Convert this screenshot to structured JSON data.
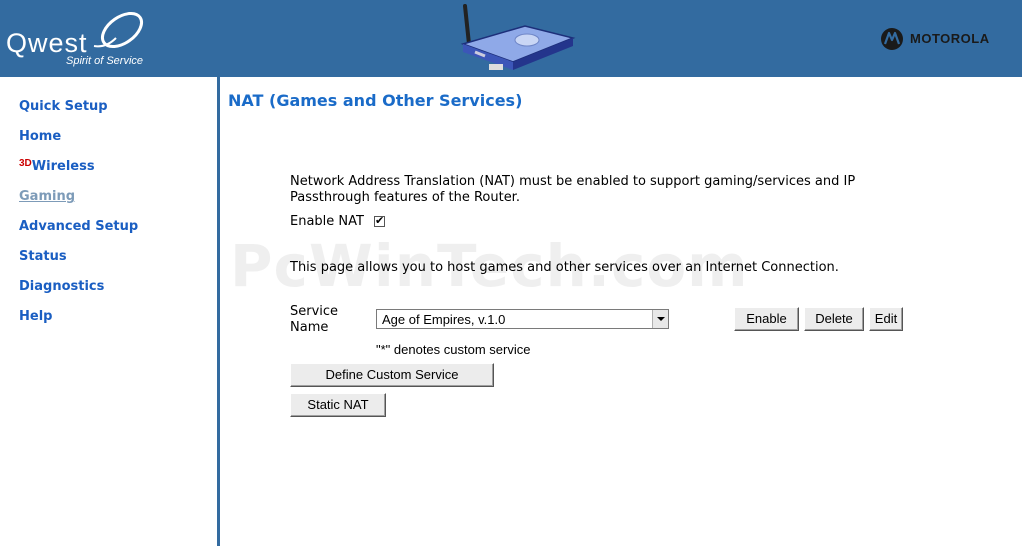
{
  "header": {
    "brand_name": "Qwest",
    "brand_tagline": "Spirit of Service",
    "partner_name": "MOTOROLA"
  },
  "sidebar": {
    "items": [
      {
        "label": "Quick Setup"
      },
      {
        "label": "Home"
      },
      {
        "label": "Wireless",
        "badge": "3D"
      },
      {
        "label": "Gaming"
      },
      {
        "label": "Advanced Setup"
      },
      {
        "label": "Status"
      },
      {
        "label": "Diagnostics"
      },
      {
        "label": "Help"
      }
    ]
  },
  "main": {
    "title": "NAT (Games and Other Services)",
    "description": "Network Address Translation (NAT) must be enabled to support gaming/services and IP Passthrough features of the Router.",
    "enable_nat_label": "Enable NAT",
    "enable_nat_checked": true,
    "host_text": "This page allows you to host games and other services over an Internet Connection.",
    "service_name_label": "Service Name",
    "service_selected": "Age of Empires, v.1.0",
    "custom_note": "\"*\" denotes custom service",
    "buttons": {
      "enable": "Enable",
      "delete": "Delete",
      "edit": "Edit",
      "define_custom": "Define Custom Service",
      "static_nat": "Static NAT"
    }
  },
  "watermark": "PcWinTech.com",
  "colors": {
    "header_bg": "#336ba0",
    "nav_link": "#1a5ec2",
    "nav_active": "#7d9bb8",
    "title": "#1a6bc8"
  }
}
